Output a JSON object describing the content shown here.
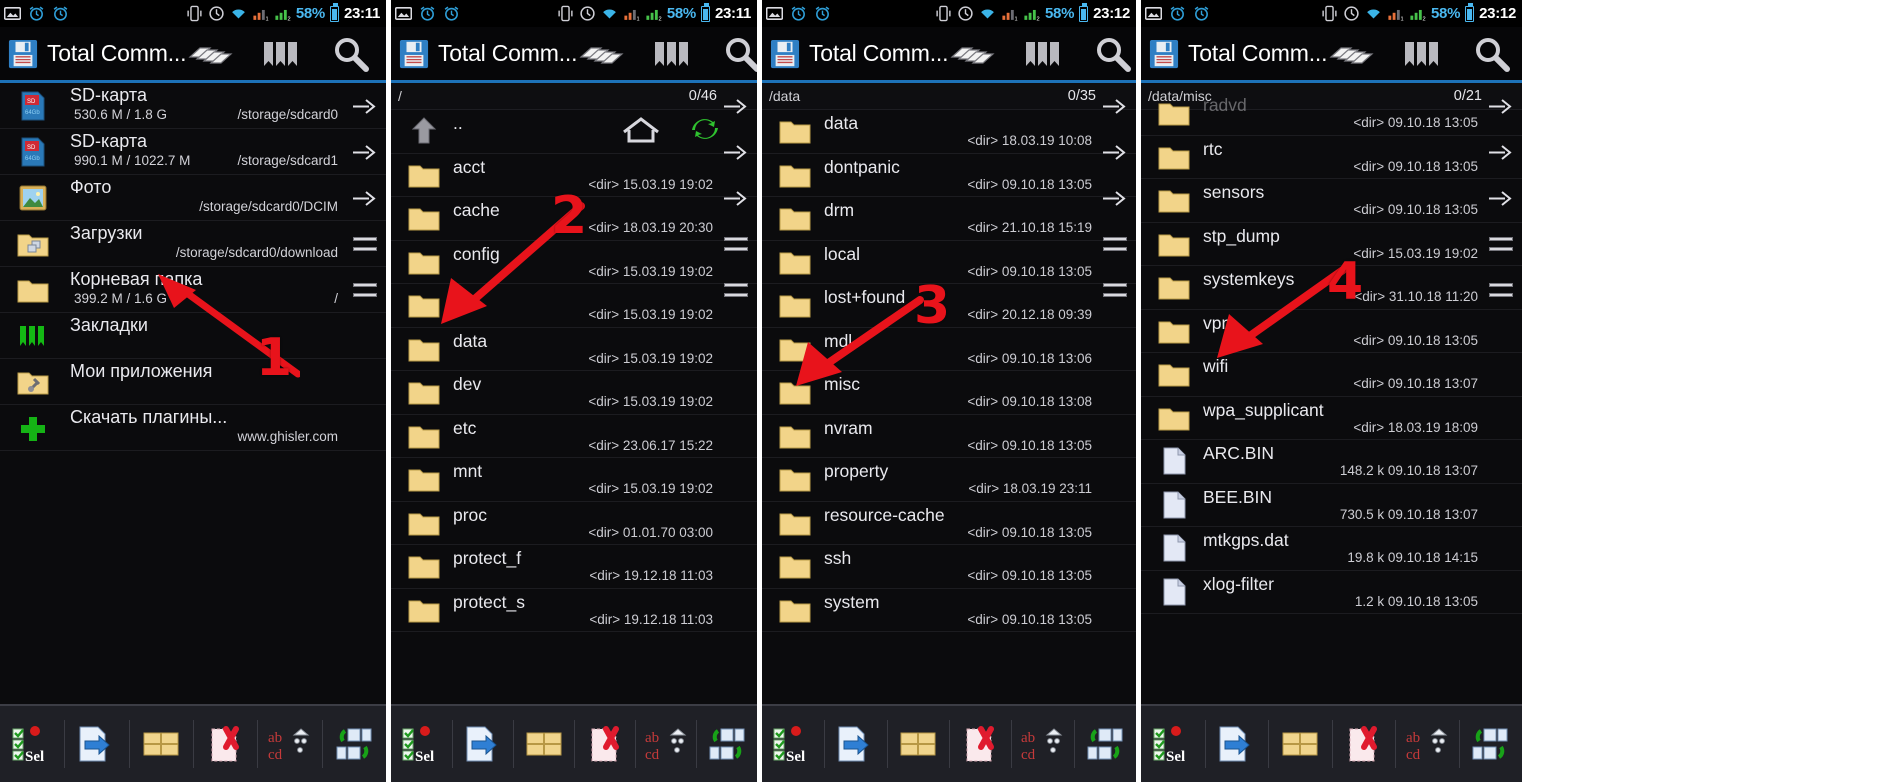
{
  "statusbar": {
    "icons_left": [
      "gallery-icon",
      "alarm-icon",
      "alarm2-icon"
    ],
    "icons_right": [
      "vibrate-icon",
      "clock-icon",
      "wifi-icon",
      "signal1-icon",
      "signal2-icon"
    ],
    "battery_percent": "58%",
    "times": [
      "23:11",
      "23:11",
      "23:12",
      "23:12"
    ]
  },
  "titlebar": {
    "app_title": "Total Comm...",
    "icons": [
      "floppy-icon",
      "cards-icon",
      "bookmarks-icon",
      "search-icon"
    ]
  },
  "rail": {
    "items": [
      "arrow-right-icon",
      "arrow-right-icon",
      "arrow-right-icon",
      "bars-icon",
      "bars-icon"
    ]
  },
  "bottombar": {
    "buttons": [
      {
        "name": "select-button",
        "label": "Sel"
      },
      {
        "name": "copy-move-button",
        "label": ""
      },
      {
        "name": "new-folder-button",
        "label": ""
      },
      {
        "name": "delete-button",
        "label": ""
      },
      {
        "name": "rename-button",
        "label": "ab cd"
      },
      {
        "name": "refresh-swap-button",
        "label": ""
      }
    ]
  },
  "panels": [
    {
      "id": "panel-home",
      "path": "",
      "count": "",
      "show_path_row": false,
      "rows": [
        {
          "icon": "sdcard-icon",
          "name": "SD-карта",
          "sub": "530.6 M / 1.8 G",
          "right": "/storage/sdcard0"
        },
        {
          "icon": "sdcard-icon",
          "name": "SD-карта",
          "sub": "990.1 M / 1022.7 M",
          "right": "/storage/sdcard1"
        },
        {
          "icon": "photo-icon",
          "name": "Фото",
          "sub": "",
          "right": "/storage/sdcard0/DCIM"
        },
        {
          "icon": "download-folder-icon",
          "name": "Загрузки",
          "sub": "",
          "right": "/storage/sdcard0/download"
        },
        {
          "icon": "folder-icon",
          "name": "Корневая папка",
          "sub": "399.2 M / 1.6 G",
          "right": "/"
        },
        {
          "icon": "bookmarks-icon",
          "name": "Закладки",
          "sub": "",
          "right": ""
        },
        {
          "icon": "apps-folder-icon",
          "name": "Мои приложения",
          "sub": "",
          "right": ""
        },
        {
          "icon": "plus-icon",
          "name": "Скачать плагины...",
          "sub": "",
          "right": "www.ghisler.com"
        }
      ]
    },
    {
      "id": "panel-root",
      "path": "/",
      "count": "0/46",
      "show_path_row": true,
      "rows": [
        {
          "icon": "up-icon",
          "name": "..",
          "meta": "",
          "home": true
        },
        {
          "icon": "folder-icon",
          "name": "acct",
          "meta": "<dir> 15.03.19 19:02"
        },
        {
          "icon": "folder-icon",
          "name": "cache",
          "meta": "<dir> 18.03.19 20:30"
        },
        {
          "icon": "folder-icon",
          "name": "config",
          "meta": "<dir> 15.03.19 19:02"
        },
        {
          "icon": "folder-icon",
          "name": "d",
          "meta": "<dir> 15.03.19 19:02"
        },
        {
          "icon": "folder-icon",
          "name": "data",
          "meta": "<dir> 15.03.19 19:02"
        },
        {
          "icon": "folder-icon",
          "name": "dev",
          "meta": "<dir> 15.03.19 19:02"
        },
        {
          "icon": "folder-icon",
          "name": "etc",
          "meta": "<dir> 23.06.17 15:22"
        },
        {
          "icon": "folder-icon",
          "name": "mnt",
          "meta": "<dir> 15.03.19 19:02"
        },
        {
          "icon": "folder-icon",
          "name": "proc",
          "meta": "<dir> 01.01.70 03:00"
        },
        {
          "icon": "folder-icon",
          "name": "protect_f",
          "meta": "<dir> 19.12.18 11:03"
        },
        {
          "icon": "folder-icon",
          "name": "protect_s",
          "meta": "<dir> 19.12.18 11:03"
        }
      ]
    },
    {
      "id": "panel-data",
      "path": "/data",
      "count": "0/35",
      "show_path_row": true,
      "rows": [
        {
          "icon": "folder-icon",
          "name": "data",
          "meta": "<dir> 18.03.19 10:08"
        },
        {
          "icon": "folder-icon",
          "name": "dontpanic",
          "meta": "<dir> 09.10.18 13:05"
        },
        {
          "icon": "folder-icon",
          "name": "drm",
          "meta": "<dir> 21.10.18 15:19"
        },
        {
          "icon": "folder-icon",
          "name": "local",
          "meta": "<dir> 09.10.18 13:05"
        },
        {
          "icon": "folder-icon",
          "name": "lost+found",
          "meta": "<dir> 20.12.18 09:39"
        },
        {
          "icon": "folder-icon",
          "name": "mdl",
          "meta": "<dir> 09.10.18 13:06"
        },
        {
          "icon": "folder-icon",
          "name": "misc",
          "meta": "<dir> 09.10.18 13:08"
        },
        {
          "icon": "folder-icon",
          "name": "nvram",
          "meta": "<dir> 09.10.18 13:05"
        },
        {
          "icon": "folder-icon",
          "name": "property",
          "meta": "<dir> 18.03.19 23:11"
        },
        {
          "icon": "folder-icon",
          "name": "resource-cache",
          "meta": "<dir> 09.10.18 13:05"
        },
        {
          "icon": "folder-icon",
          "name": "ssh",
          "meta": "<dir> 09.10.18 13:05"
        },
        {
          "icon": "folder-icon",
          "name": "system",
          "meta": "<dir> 09.10.18 13:05"
        }
      ]
    },
    {
      "id": "panel-misc",
      "path": "/data/misc",
      "count": "0/21",
      "show_path_row": true,
      "rows": [
        {
          "icon": "folder-icon",
          "name": "radvd",
          "meta": "<dir> 09.10.18 13:05",
          "clipped": true
        },
        {
          "icon": "folder-icon",
          "name": "rtc",
          "meta": "<dir> 09.10.18 13:05"
        },
        {
          "icon": "folder-icon",
          "name": "sensors",
          "meta": "<dir> 09.10.18 13:05"
        },
        {
          "icon": "folder-icon",
          "name": "stp_dump",
          "meta": "<dir> 15.03.19 19:02"
        },
        {
          "icon": "folder-icon",
          "name": "systemkeys",
          "meta": "<dir> 31.10.18 11:20"
        },
        {
          "icon": "folder-icon",
          "name": "vpn",
          "meta": "<dir> 09.10.18 13:05"
        },
        {
          "icon": "folder-icon",
          "name": "wifi",
          "meta": "<dir> 09.10.18 13:07"
        },
        {
          "icon": "folder-icon",
          "name": "wpa_supplicant",
          "meta": "<dir> 18.03.19 18:09"
        },
        {
          "icon": "file-icon",
          "name": "ARC.BIN",
          "meta": "148.2 k 09.10.18 13:07"
        },
        {
          "icon": "file-icon",
          "name": "BEE.BIN",
          "meta": "730.5 k 09.10.18 13:07"
        },
        {
          "icon": "file-icon",
          "name": "mtkgps.dat",
          "meta": "19.8 k 09.10.18 14:15"
        },
        {
          "icon": "file-icon",
          "name": "xlog-filter",
          "meta": "1.2 k 09.10.18 13:05"
        }
      ]
    }
  ],
  "annotations": [
    {
      "number": "1",
      "panel": 0
    },
    {
      "number": "2",
      "panel": 1
    },
    {
      "number": "3",
      "panel": 2
    },
    {
      "number": "4",
      "panel": 3
    }
  ],
  "colors": {
    "accent_blue": "#1d72b8",
    "annotation_red": "#e8131b",
    "folder_yellow": "#f2d489",
    "battery_blue": "#4ab8f0"
  }
}
